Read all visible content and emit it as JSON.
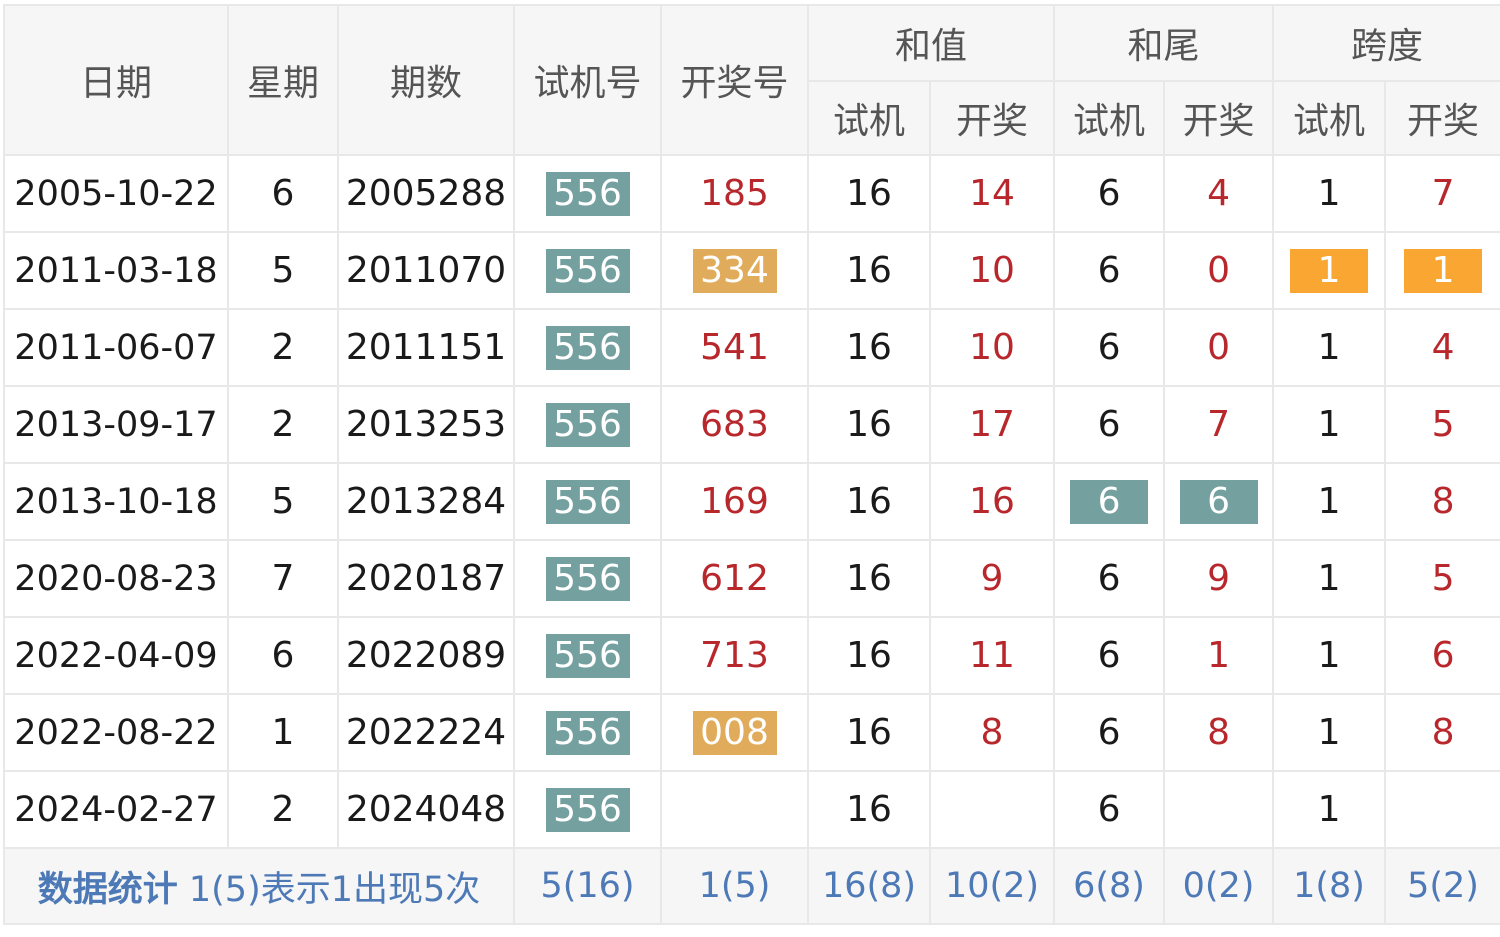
{
  "headers": {
    "date": "日期",
    "weekday": "星期",
    "issue": "期数",
    "trial": "试机号",
    "draw": "开奖号",
    "sum": "和值",
    "tail": "和尾",
    "span": "跨度",
    "sub_trial": "试机",
    "sub_draw": "开奖"
  },
  "rows": [
    {
      "date": "2005-10-22",
      "weekday": "6",
      "issue": "2005288",
      "trial": "556",
      "draw": "185",
      "sum_trial": "16",
      "sum_draw": "14",
      "tail_trial": "6",
      "tail_draw": "4",
      "span_trial": "1",
      "span_draw": "7"
    },
    {
      "date": "2011-03-18",
      "weekday": "5",
      "issue": "2011070",
      "trial": "556",
      "draw": "334",
      "sum_trial": "16",
      "sum_draw": "10",
      "tail_trial": "6",
      "tail_draw": "0",
      "span_trial": "1",
      "span_draw": "1"
    },
    {
      "date": "2011-06-07",
      "weekday": "2",
      "issue": "2011151",
      "trial": "556",
      "draw": "541",
      "sum_trial": "16",
      "sum_draw": "10",
      "tail_trial": "6",
      "tail_draw": "0",
      "span_trial": "1",
      "span_draw": "4"
    },
    {
      "date": "2013-09-17",
      "weekday": "2",
      "issue": "2013253",
      "trial": "556",
      "draw": "683",
      "sum_trial": "16",
      "sum_draw": "17",
      "tail_trial": "6",
      "tail_draw": "7",
      "span_trial": "1",
      "span_draw": "5"
    },
    {
      "date": "2013-10-18",
      "weekday": "5",
      "issue": "2013284",
      "trial": "556",
      "draw": "169",
      "sum_trial": "16",
      "sum_draw": "16",
      "tail_trial": "6",
      "tail_draw": "6",
      "span_trial": "1",
      "span_draw": "8"
    },
    {
      "date": "2020-08-23",
      "weekday": "7",
      "issue": "2020187",
      "trial": "556",
      "draw": "612",
      "sum_trial": "16",
      "sum_draw": "9",
      "tail_trial": "6",
      "tail_draw": "9",
      "span_trial": "1",
      "span_draw": "5"
    },
    {
      "date": "2022-04-09",
      "weekday": "6",
      "issue": "2022089",
      "trial": "556",
      "draw": "713",
      "sum_trial": "16",
      "sum_draw": "11",
      "tail_trial": "6",
      "tail_draw": "1",
      "span_trial": "1",
      "span_draw": "6"
    },
    {
      "date": "2022-08-22",
      "weekday": "1",
      "issue": "2022224",
      "trial": "556",
      "draw": "008",
      "sum_trial": "16",
      "sum_draw": "8",
      "tail_trial": "6",
      "tail_draw": "8",
      "span_trial": "1",
      "span_draw": "8"
    },
    {
      "date": "2024-02-27",
      "weekday": "2",
      "issue": "2024048",
      "trial": "556",
      "draw": "",
      "sum_trial": "16",
      "sum_draw": "",
      "tail_trial": "6",
      "tail_draw": "",
      "span_trial": "1",
      "span_draw": ""
    }
  ],
  "stats": {
    "title": "数据统计",
    "note": "1(5)表示1出现5次",
    "trial": "5(16)",
    "draw": "1(5)",
    "sum_trial": "16(8)",
    "sum_draw": "10(2)",
    "tail_trial": "6(8)",
    "tail_draw": "0(2)",
    "span_trial": "1(8)",
    "span_draw": "5(2)"
  },
  "colors": {
    "header_bg": "#f6f6f6",
    "border": "#e8e8e8",
    "draw_red": "#b8272b",
    "badge_teal": "#74a0a0",
    "badge_gold": "#e0ac5c",
    "badge_orange": "#f9a633",
    "stats_blue": "#4d79b6"
  }
}
